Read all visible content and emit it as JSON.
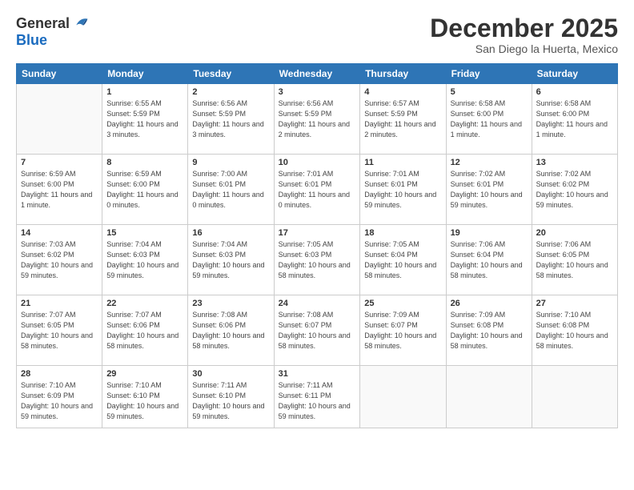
{
  "logo": {
    "general": "General",
    "blue": "Blue"
  },
  "title": "December 2025",
  "location": "San Diego la Huerta, Mexico",
  "weekdays": [
    "Sunday",
    "Monday",
    "Tuesday",
    "Wednesday",
    "Thursday",
    "Friday",
    "Saturday"
  ],
  "weeks": [
    [
      {
        "day": "",
        "sunrise": "",
        "sunset": "",
        "daylight": ""
      },
      {
        "day": "1",
        "sunrise": "Sunrise: 6:55 AM",
        "sunset": "Sunset: 5:59 PM",
        "daylight": "Daylight: 11 hours and 3 minutes."
      },
      {
        "day": "2",
        "sunrise": "Sunrise: 6:56 AM",
        "sunset": "Sunset: 5:59 PM",
        "daylight": "Daylight: 11 hours and 3 minutes."
      },
      {
        "day": "3",
        "sunrise": "Sunrise: 6:56 AM",
        "sunset": "Sunset: 5:59 PM",
        "daylight": "Daylight: 11 hours and 2 minutes."
      },
      {
        "day": "4",
        "sunrise": "Sunrise: 6:57 AM",
        "sunset": "Sunset: 5:59 PM",
        "daylight": "Daylight: 11 hours and 2 minutes."
      },
      {
        "day": "5",
        "sunrise": "Sunrise: 6:58 AM",
        "sunset": "Sunset: 6:00 PM",
        "daylight": "Daylight: 11 hours and 1 minute."
      },
      {
        "day": "6",
        "sunrise": "Sunrise: 6:58 AM",
        "sunset": "Sunset: 6:00 PM",
        "daylight": "Daylight: 11 hours and 1 minute."
      }
    ],
    [
      {
        "day": "7",
        "sunrise": "Sunrise: 6:59 AM",
        "sunset": "Sunset: 6:00 PM",
        "daylight": "Daylight: 11 hours and 1 minute."
      },
      {
        "day": "8",
        "sunrise": "Sunrise: 6:59 AM",
        "sunset": "Sunset: 6:00 PM",
        "daylight": "Daylight: 11 hours and 0 minutes."
      },
      {
        "day": "9",
        "sunrise": "Sunrise: 7:00 AM",
        "sunset": "Sunset: 6:01 PM",
        "daylight": "Daylight: 11 hours and 0 minutes."
      },
      {
        "day": "10",
        "sunrise": "Sunrise: 7:01 AM",
        "sunset": "Sunset: 6:01 PM",
        "daylight": "Daylight: 11 hours and 0 minutes."
      },
      {
        "day": "11",
        "sunrise": "Sunrise: 7:01 AM",
        "sunset": "Sunset: 6:01 PM",
        "daylight": "Daylight: 10 hours and 59 minutes."
      },
      {
        "day": "12",
        "sunrise": "Sunrise: 7:02 AM",
        "sunset": "Sunset: 6:01 PM",
        "daylight": "Daylight: 10 hours and 59 minutes."
      },
      {
        "day": "13",
        "sunrise": "Sunrise: 7:02 AM",
        "sunset": "Sunset: 6:02 PM",
        "daylight": "Daylight: 10 hours and 59 minutes."
      }
    ],
    [
      {
        "day": "14",
        "sunrise": "Sunrise: 7:03 AM",
        "sunset": "Sunset: 6:02 PM",
        "daylight": "Daylight: 10 hours and 59 minutes."
      },
      {
        "day": "15",
        "sunrise": "Sunrise: 7:04 AM",
        "sunset": "Sunset: 6:03 PM",
        "daylight": "Daylight: 10 hours and 59 minutes."
      },
      {
        "day": "16",
        "sunrise": "Sunrise: 7:04 AM",
        "sunset": "Sunset: 6:03 PM",
        "daylight": "Daylight: 10 hours and 59 minutes."
      },
      {
        "day": "17",
        "sunrise": "Sunrise: 7:05 AM",
        "sunset": "Sunset: 6:03 PM",
        "daylight": "Daylight: 10 hours and 58 minutes."
      },
      {
        "day": "18",
        "sunrise": "Sunrise: 7:05 AM",
        "sunset": "Sunset: 6:04 PM",
        "daylight": "Daylight: 10 hours and 58 minutes."
      },
      {
        "day": "19",
        "sunrise": "Sunrise: 7:06 AM",
        "sunset": "Sunset: 6:04 PM",
        "daylight": "Daylight: 10 hours and 58 minutes."
      },
      {
        "day": "20",
        "sunrise": "Sunrise: 7:06 AM",
        "sunset": "Sunset: 6:05 PM",
        "daylight": "Daylight: 10 hours and 58 minutes."
      }
    ],
    [
      {
        "day": "21",
        "sunrise": "Sunrise: 7:07 AM",
        "sunset": "Sunset: 6:05 PM",
        "daylight": "Daylight: 10 hours and 58 minutes."
      },
      {
        "day": "22",
        "sunrise": "Sunrise: 7:07 AM",
        "sunset": "Sunset: 6:06 PM",
        "daylight": "Daylight: 10 hours and 58 minutes."
      },
      {
        "day": "23",
        "sunrise": "Sunrise: 7:08 AM",
        "sunset": "Sunset: 6:06 PM",
        "daylight": "Daylight: 10 hours and 58 minutes."
      },
      {
        "day": "24",
        "sunrise": "Sunrise: 7:08 AM",
        "sunset": "Sunset: 6:07 PM",
        "daylight": "Daylight: 10 hours and 58 minutes."
      },
      {
        "day": "25",
        "sunrise": "Sunrise: 7:09 AM",
        "sunset": "Sunset: 6:07 PM",
        "daylight": "Daylight: 10 hours and 58 minutes."
      },
      {
        "day": "26",
        "sunrise": "Sunrise: 7:09 AM",
        "sunset": "Sunset: 6:08 PM",
        "daylight": "Daylight: 10 hours and 58 minutes."
      },
      {
        "day": "27",
        "sunrise": "Sunrise: 7:10 AM",
        "sunset": "Sunset: 6:08 PM",
        "daylight": "Daylight: 10 hours and 58 minutes."
      }
    ],
    [
      {
        "day": "28",
        "sunrise": "Sunrise: 7:10 AM",
        "sunset": "Sunset: 6:09 PM",
        "daylight": "Daylight: 10 hours and 59 minutes."
      },
      {
        "day": "29",
        "sunrise": "Sunrise: 7:10 AM",
        "sunset": "Sunset: 6:10 PM",
        "daylight": "Daylight: 10 hours and 59 minutes."
      },
      {
        "day": "30",
        "sunrise": "Sunrise: 7:11 AM",
        "sunset": "Sunset: 6:10 PM",
        "daylight": "Daylight: 10 hours and 59 minutes."
      },
      {
        "day": "31",
        "sunrise": "Sunrise: 7:11 AM",
        "sunset": "Sunset: 6:11 PM",
        "daylight": "Daylight: 10 hours and 59 minutes."
      },
      {
        "day": "",
        "sunrise": "",
        "sunset": "",
        "daylight": ""
      },
      {
        "day": "",
        "sunrise": "",
        "sunset": "",
        "daylight": ""
      },
      {
        "day": "",
        "sunrise": "",
        "sunset": "",
        "daylight": ""
      }
    ]
  ]
}
